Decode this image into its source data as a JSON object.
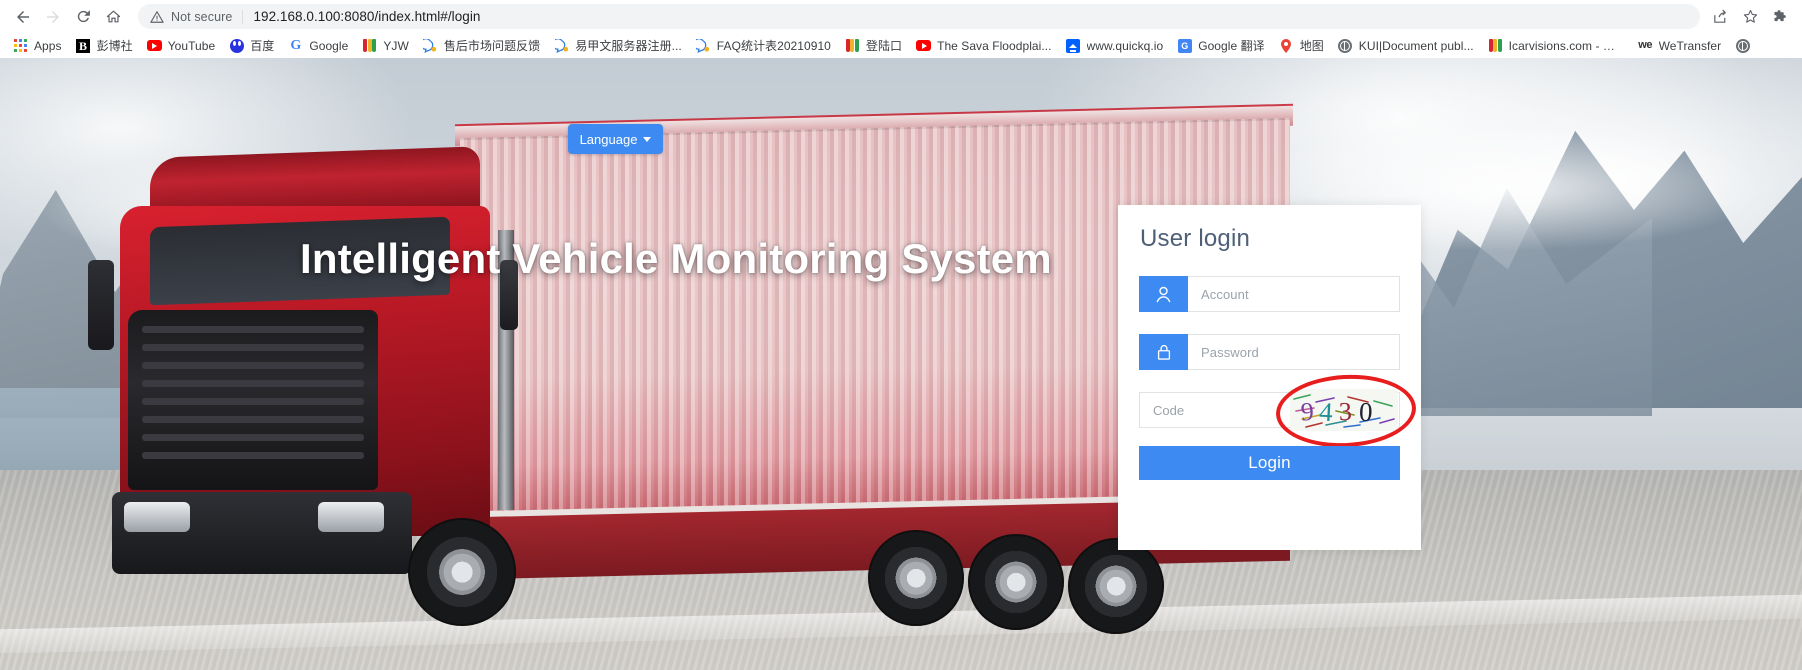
{
  "browser": {
    "back_label": "Back",
    "forward_label": "Forward",
    "reload_label": "Reload",
    "home_label": "Home",
    "security_text": "Not secure",
    "url": "192.168.0.100:8080/index.html#/login",
    "url_host": "192.168.0.100:8080",
    "url_path": "/index.html#/login",
    "share_label": "Share",
    "bookmark_label": "Bookmark this tab",
    "extensions_label": "Extensions"
  },
  "bookmarks": [
    {
      "label": "Apps",
      "icon": "apps-grid-icon"
    },
    {
      "label": "彭博社",
      "icon": "bloomberg-b-icon"
    },
    {
      "label": "YouTube",
      "icon": "youtube-icon"
    },
    {
      "label": "百度",
      "icon": "baidu-icon"
    },
    {
      "label": "Google",
      "icon": "google-g-icon"
    },
    {
      "label": "YJW",
      "icon": "shield-stripes-icon"
    },
    {
      "label": "售后市场问题反馈",
      "icon": "quark-speech-icon"
    },
    {
      "label": "易甲文服务器注册...",
      "icon": "quark-speech-icon"
    },
    {
      "label": "FAQ统计表20210910",
      "icon": "quark-speech-icon"
    },
    {
      "label": "登陆口",
      "icon": "shield-stripes-icon"
    },
    {
      "label": "The Sava Floodplai...",
      "icon": "youtube-icon"
    },
    {
      "label": "www.quickq.io",
      "icon": "quickq-icon"
    },
    {
      "label": "Google 翻译",
      "icon": "google-translate-icon"
    },
    {
      "label": "地图",
      "icon": "google-maps-pin-icon"
    },
    {
      "label": "KUI|Document publ...",
      "icon": "globe-icon"
    },
    {
      "label": "Icarvisions.com - 后...",
      "icon": "shield-stripes-icon"
    },
    {
      "label": "WeTransfer",
      "icon": "wetransfer-icon"
    }
  ],
  "hero": {
    "title": "Intelligent Vehicle Monitoring System",
    "language_button": "Language",
    "language_caret": "chevron-down-icon"
  },
  "login": {
    "heading": "User login",
    "account_placeholder": "Account",
    "account_value": "",
    "account_icon": "user-icon",
    "password_placeholder": "Password",
    "password_value": "",
    "password_icon": "lock-icon",
    "code_placeholder": "Code",
    "code_value": "",
    "captcha_text": "9430",
    "submit_label": "Login"
  },
  "colors": {
    "accent_blue": "#3d8bf2",
    "heading_slate": "#4e5f78",
    "placeholder_gray": "#9ba2a9",
    "captcha_ring_red": "#e81d1d",
    "truck_red": "#c02330"
  }
}
